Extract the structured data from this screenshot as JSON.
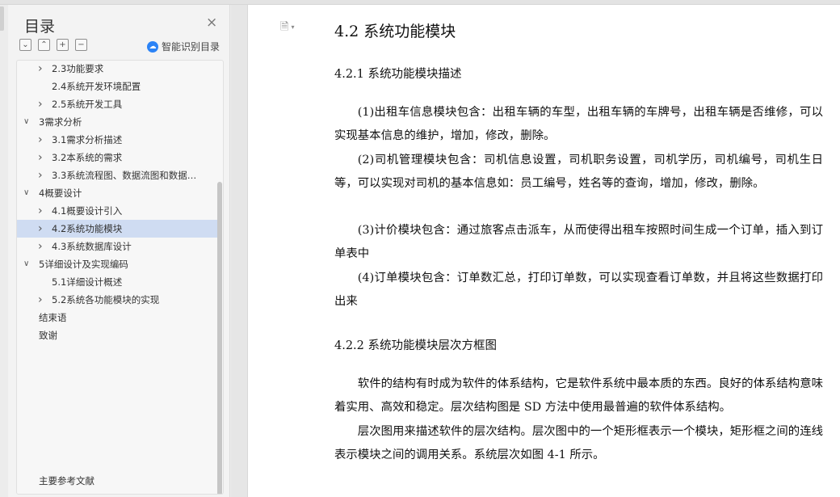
{
  "sidebar": {
    "title": "目录",
    "close_label": "×",
    "tools": [
      "⌄",
      "⌃",
      "+",
      "−"
    ],
    "ai_icon": "ai-cloud-icon",
    "ai_label": "智能识别目录",
    "toc": [
      {
        "label": "2.3功能要求",
        "level": 2,
        "expandable": true,
        "expanded": false,
        "active": false
      },
      {
        "label": "2.4系统开发环境配置",
        "level": 2,
        "expandable": false,
        "expanded": false,
        "active": false
      },
      {
        "label": "2.5系统开发工具",
        "level": 2,
        "expandable": true,
        "expanded": false,
        "active": false
      },
      {
        "label": "3需求分析",
        "level": 1,
        "expandable": true,
        "expanded": true,
        "active": false
      },
      {
        "label": "3.1需求分析描述",
        "level": 2,
        "expandable": true,
        "expanded": false,
        "active": false
      },
      {
        "label": "3.2本系统的需求",
        "level": 2,
        "expandable": true,
        "expanded": false,
        "active": false
      },
      {
        "label": "3.3系统流程图、数据流图和数据…",
        "level": 2,
        "expandable": true,
        "expanded": false,
        "active": false
      },
      {
        "label": "4概要设计",
        "level": 1,
        "expandable": true,
        "expanded": true,
        "active": false
      },
      {
        "label": "4.1概要设计引入",
        "level": 2,
        "expandable": true,
        "expanded": false,
        "active": false
      },
      {
        "label": "4.2系统功能模块",
        "level": 2,
        "expandable": true,
        "expanded": false,
        "active": true
      },
      {
        "label": "4.3系统数据库设计",
        "level": 2,
        "expandable": true,
        "expanded": false,
        "active": false
      },
      {
        "label": "5详细设计及实现编码",
        "level": 1,
        "expandable": true,
        "expanded": true,
        "active": false
      },
      {
        "label": "5.1详细设计概述",
        "level": 2,
        "expandable": false,
        "expanded": false,
        "active": false
      },
      {
        "label": "5.2系统各功能模块的实现",
        "level": 2,
        "expandable": true,
        "expanded": false,
        "active": false
      },
      {
        "label": "结束语",
        "level": 1,
        "expandable": false,
        "expanded": false,
        "active": false
      },
      {
        "label": "致谢",
        "level": 1,
        "expandable": false,
        "expanded": false,
        "active": false
      }
    ],
    "toc_bottom": "主要参考文献"
  },
  "document": {
    "page_icon": "document-icon",
    "heading": "4.2  系统功能模块",
    "sub1": "4.2.1  系统功能模块描述",
    "p1": "(1)出租车信息模块包含：出租车辆的车型，出租车辆的车牌号，出租车辆是否维修，可以实现基本信息的维护，增加，修改，删除。",
    "p2": "(2)司机管理模块包含：司机信息设置，司机职务设置，司机学历，司机编号，司机生日等，可以实现对司机的基本信息如：员工编号，姓名等的查询，增加，修改，删除。",
    "p3": "(3)计价模块包含：通过旅客点击派车，从而使得出租车按照时间生成一个订单，插入到订单表中",
    "p4": "(4)订单模块包含：订单数汇总，打印订单数，可以实现查看订单数，并且将这些数据打印出来",
    "sub2": "4.2.2  系统功能模块层次方框图",
    "p5": "软件的结构有时成为软件的体系结构，它是软件系统中最本质的东西。良好的体系结构意味着实用、高效和稳定。层次结构图是 SD 方法中使用最普遍的软件体系结构。",
    "p6": "层次图用来描述软件的层次结构。层次图中的一个矩形框表示一个模块，矩形框之间的连线表示模块之间的调用关系。系统层次如图 4-1 所示。"
  }
}
